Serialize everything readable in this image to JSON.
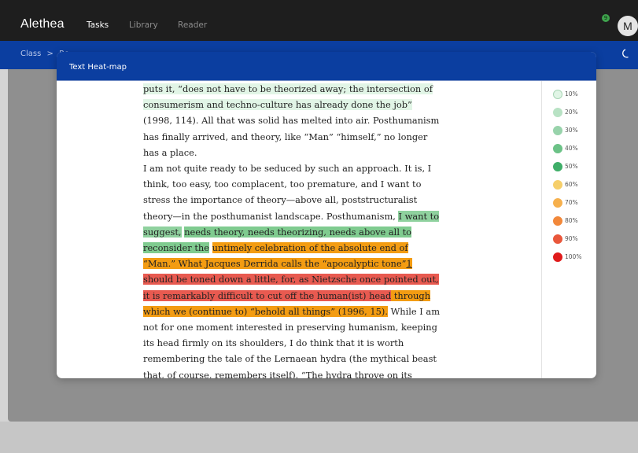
{
  "app": {
    "brand": "Alethea",
    "nav": [
      {
        "label": "Tasks",
        "active": true
      },
      {
        "label": "Library",
        "active": false
      },
      {
        "label": "Reader",
        "active": false
      }
    ],
    "notification_count": "9",
    "avatar_initial": "M"
  },
  "breadcrumb": {
    "items": [
      "Class",
      "Re"
    ]
  },
  "modal": {
    "title": "Text Heat-map",
    "segments": [
      [
        {
          "t": "puts it, “does not have to be theorized away; the intersection of consumerism and techno-culture has already done the job”",
          "h": "h10"
        },
        {
          "t": " (1998, 114). All that was solid has melted into air. Posthumanism has finally arrived, and theory, like “Man” “himself,” no longer has a place.",
          "h": ""
        }
      ],
      [
        {
          "t": "I am not quite ready to be seduced by such an approach. It is, I think, too easy, too complacent, too premature, and I want to stress the importance of theory—above all, poststructuralist theory—in the posthumanist landscape. Posthumanism, ",
          "h": ""
        },
        {
          "t": "I want to suggest,",
          "h": "h40"
        },
        {
          "t": " ",
          "h": ""
        },
        {
          "t": "needs theory, needs theorizing, needs above all to reconsider the",
          "h": "h40b"
        },
        {
          "t": " ",
          "h": ""
        },
        {
          "t": "untimely celebration of the absolute end of “Man.” What Jacques Derrida calls the “apocalyptic tone”",
          "h": "h70"
        },
        {
          "t": "1",
          "h": "h70",
          "fn": true
        },
        {
          "t": " should be toned down a little, for, as Nietzsche once pointed out, it is remarkably difficult to cut off the human(ist) head",
          "h": "h100"
        },
        {
          "t": " through which we (continue to) “behold all things” (1996, 15).",
          "h": "h70b"
        },
        {
          "t": " While I am not for one moment interested in preserving humanism, keeping its head firmly on its shoulders, I do think that it is worth remembering the tale of the Lernaean hydra (the mythical beast that, of course, remembers itself). “The hydra throve on its wounds,” Ovid recalls, “and none of its hundred heads could be cut off with impunity.”",
          "h": ""
        }
      ]
    ],
    "legend": [
      {
        "label": "10%",
        "color": "#e1f5e6",
        "border": "#a8d5b5"
      },
      {
        "label": "20%",
        "color": "#b8e2c4",
        "border": "#b8e2c4"
      },
      {
        "label": "30%",
        "color": "#98d3ab",
        "border": "#98d3ab"
      },
      {
        "label": "40%",
        "color": "#6cc287",
        "border": "#6cc287"
      },
      {
        "label": "50%",
        "color": "#3fae68",
        "border": "#3fae68"
      },
      {
        "label": "60%",
        "color": "#f6cf6a",
        "border": "#f6cf6a"
      },
      {
        "label": "70%",
        "color": "#f6b04d",
        "border": "#f6b04d"
      },
      {
        "label": "80%",
        "color": "#f2883a",
        "border": "#f2883a"
      },
      {
        "label": "90%",
        "color": "#e9573b",
        "border": "#e9573b"
      },
      {
        "label": "100%",
        "color": "#e01b1b",
        "border": "#e01b1b"
      }
    ]
  },
  "colors": {
    "topbar": "#1e1e1e",
    "brand_blue": "#0b3ea0",
    "backdrop": "#8f8f8f"
  }
}
